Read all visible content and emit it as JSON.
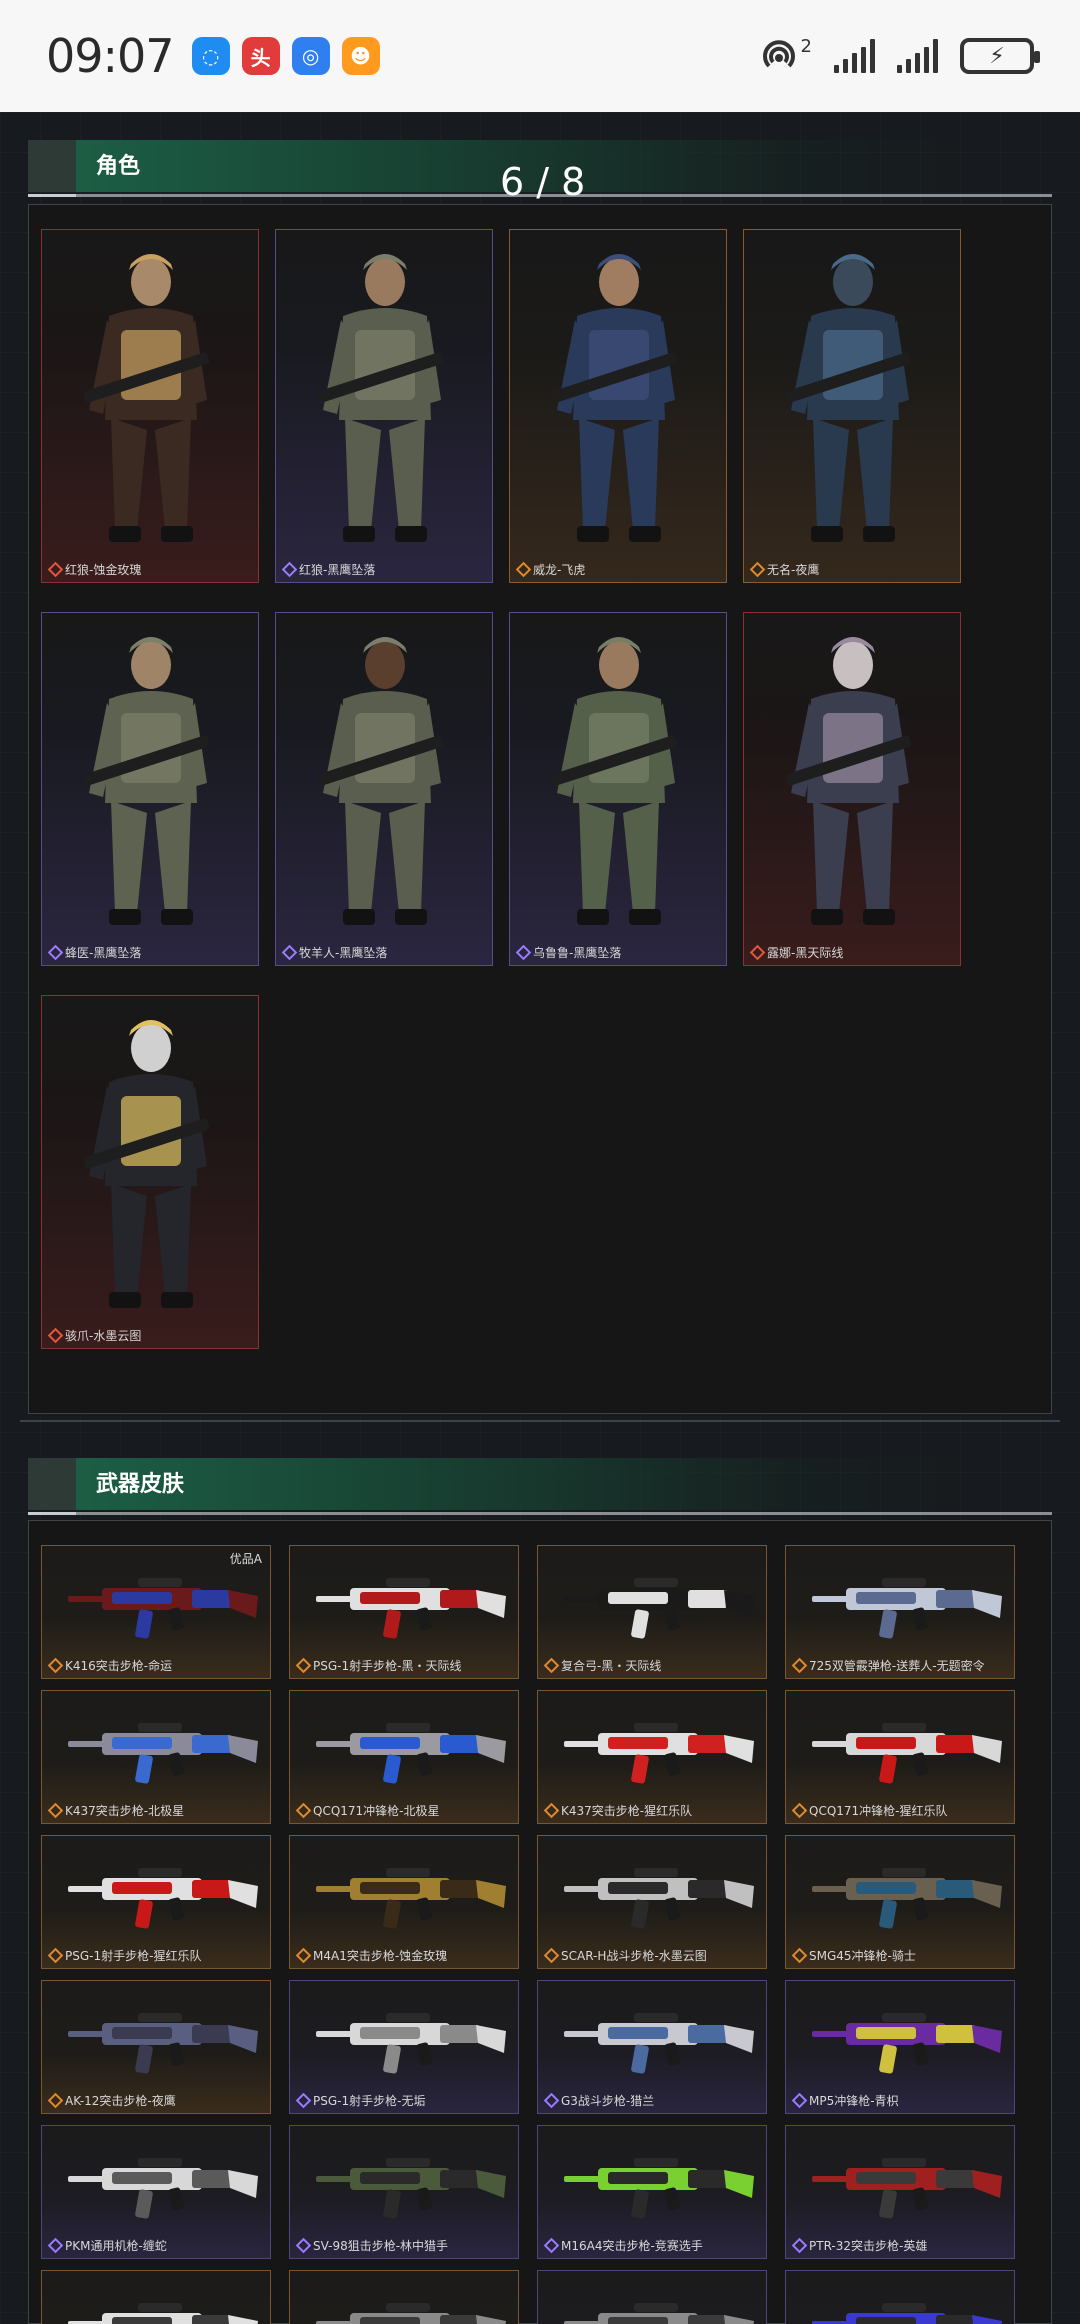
{
  "status": {
    "time": "09:07",
    "app_icons": [
      {
        "name": "message-app-icon",
        "color": "#1e8cf0",
        "glyph": "◌"
      },
      {
        "name": "news-app-icon",
        "color": "#e23b3b",
        "glyph": "头"
      },
      {
        "name": "browser-app-icon",
        "color": "#2f7ff0",
        "glyph": "◎"
      },
      {
        "name": "game-app-icon",
        "color": "#ff9a1f",
        "glyph": "☻"
      }
    ],
    "hotspot_badge": "2",
    "battery_glyph": "⚡"
  },
  "characters_section": {
    "title": "角色",
    "page_indicator": "6 / 8",
    "items": [
      {
        "label": "红狼-蚀金玫瑰",
        "rarity": "red",
        "palette": {
          "skin": "#a88a6a",
          "body": "#3a2a22",
          "accent": "#c8a060"
        }
      },
      {
        "label": "红狼-黑鹰坠落",
        "rarity": "purple",
        "palette": {
          "skin": "#9a7a5e",
          "body": "#5a5e4e",
          "accent": "#7a7e6a"
        }
      },
      {
        "label": "威龙-飞虎",
        "rarity": "orange",
        "palette": {
          "skin": "#a07c60",
          "body": "#2a3a5a",
          "accent": "#3e4e7a"
        }
      },
      {
        "label": "无名-夜鹰",
        "rarity": "orange",
        "palette": {
          "skin": "#3a4a5a",
          "body": "#2a3a4e",
          "accent": "#4a6a8a"
        }
      },
      {
        "label": "蜂医-黑鹰坠落",
        "rarity": "purple",
        "palette": {
          "skin": "#a08468",
          "body": "#5e6250",
          "accent": "#7c806a"
        }
      },
      {
        "label": "牧羊人-黑鹰坠落",
        "rarity": "purple",
        "palette": {
          "skin": "#5a3e2e",
          "body": "#5a5e4e",
          "accent": "#7a7e6a"
        }
      },
      {
        "label": "乌鲁鲁-黑鹰坠落",
        "rarity": "purple",
        "palette": {
          "skin": "#9a7a5e",
          "body": "#55604a",
          "accent": "#767f66"
        }
      },
      {
        "label": "露娜-黑天际线",
        "rarity": "red",
        "palette": {
          "skin": "#c8c0c0",
          "body": "#3a3e4e",
          "accent": "#9a8aa0"
        }
      },
      {
        "label": "骇爪-水墨云图",
        "rarity": "red",
        "palette": {
          "skin": "#d0d0d0",
          "body": "#24262c",
          "accent": "#e0c060"
        }
      }
    ]
  },
  "weapons_section": {
    "title": "武器皮肤",
    "items": [
      {
        "label": "K416突击步枪-命运",
        "rarity": "o",
        "tag": "优品A",
        "colors": [
          "#6a1a1a",
          "#2a3aa0"
        ]
      },
      {
        "label": "PSG-1射手步枪-黑・天际线",
        "rarity": "o",
        "tag": "",
        "colors": [
          "#e0e0e0",
          "#b01a1a"
        ]
      },
      {
        "label": "复合弓-黑・天际线",
        "rarity": "o",
        "tag": "",
        "colors": [
          "#1a1a1a",
          "#e0e0e0"
        ]
      },
      {
        "label": "725双管霰弹枪-送葬人-无题密令",
        "rarity": "o",
        "tag": "",
        "colors": [
          "#c0c8d8",
          "#5a6a90"
        ]
      },
      {
        "label": "K437突击步枪-北极星",
        "rarity": "o",
        "tag": "",
        "colors": [
          "#8a8a9a",
          "#3a6ad0"
        ]
      },
      {
        "label": "QCQ171冲锋枪-北极星",
        "rarity": "o",
        "tag": "",
        "colors": [
          "#9a9aa0",
          "#2a5ad0"
        ]
      },
      {
        "label": "K437突击步枪-猩红乐队",
        "rarity": "o",
        "tag": "",
        "colors": [
          "#e0e0e0",
          "#d02020"
        ]
      },
      {
        "label": "QCQ171冲锋枪-猩红乐队",
        "rarity": "o",
        "tag": "",
        "colors": [
          "#d8d8d8",
          "#c81818"
        ]
      },
      {
        "label": "PSG-1射手步枪-猩红乐队",
        "rarity": "o",
        "tag": "",
        "colors": [
          "#e0e0e0",
          "#c81818"
        ]
      },
      {
        "label": "M4A1突击步枪-蚀金玫瑰",
        "rarity": "o",
        "tag": "",
        "colors": [
          "#a08030",
          "#3a2a18"
        ]
      },
      {
        "label": "SCAR-H战斗步枪-水墨云图",
        "rarity": "o",
        "tag": "",
        "colors": [
          "#c0c0c0",
          "#2a2a2a"
        ]
      },
      {
        "label": "SMG45冲锋枪-骑士",
        "rarity": "o",
        "tag": "",
        "colors": [
          "#6a6050",
          "#2a5a7a"
        ]
      },
      {
        "label": "AK-12突击步枪-夜鹰",
        "rarity": "o",
        "tag": "",
        "colors": [
          "#5a5e80",
          "#3a3a50"
        ]
      },
      {
        "label": "PSG-1射手步枪-无垢",
        "rarity": "p",
        "tag": "",
        "colors": [
          "#d8d8d8",
          "#8a8a8a"
        ]
      },
      {
        "label": "G3战斗步枪-猎兰",
        "rarity": "p",
        "tag": "",
        "colors": [
          "#c8c8d0",
          "#4a6aa0"
        ]
      },
      {
        "label": "MP5冲锋枪-青枳",
        "rarity": "p",
        "tag": "",
        "colors": [
          "#6a2aa0",
          "#d0c040"
        ]
      },
      {
        "label": "PKM通用机枪-缠蛇",
        "rarity": "p",
        "tag": "",
        "colors": [
          "#d8d8d8",
          "#5a5a5a"
        ]
      },
      {
        "label": "SV-98狙击步枪-林中猎手",
        "rarity": "p",
        "tag": "",
        "colors": [
          "#4a5a3a",
          "#2a2a2a"
        ]
      },
      {
        "label": "M16A4突击步枪-竞赛选手",
        "rarity": "p",
        "tag": "",
        "colors": [
          "#7ad030",
          "#2a2a2a"
        ]
      },
      {
        "label": "PTR-32突击步枪-英雄",
        "rarity": "p",
        "tag": "",
        "colors": [
          "#a02020",
          "#3a3a3a"
        ]
      },
      {
        "label": "",
        "rarity": "o",
        "tag": "",
        "colors": [
          "#e0e0e0",
          "#3a3a3a"
        ]
      },
      {
        "label": "",
        "rarity": "o",
        "tag": "",
        "colors": [
          "#8a8a8a",
          "#3a3a3a"
        ]
      },
      {
        "label": "",
        "rarity": "p",
        "tag": "",
        "colors": [
          "#8a8a8a",
          "#3a3a3a"
        ]
      },
      {
        "label": "",
        "rarity": "p",
        "tag": "",
        "colors": [
          "#3a3ad0",
          "#2a2a2a"
        ]
      }
    ]
  }
}
